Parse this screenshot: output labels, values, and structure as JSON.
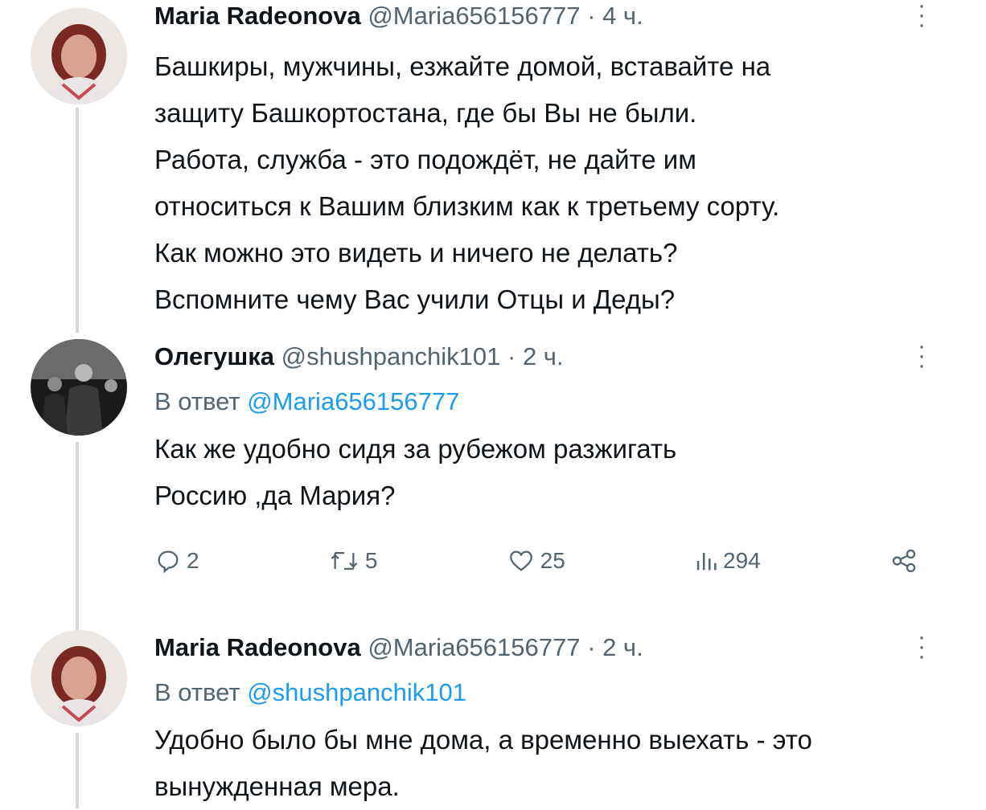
{
  "tweets": [
    {
      "name": "Maria Radeonova",
      "handle": "@Maria656156777",
      "separator": "·",
      "time": "4 ч.",
      "text_lines": [
        "Башкиры, мужчины, езжайте домой, вставайте на",
        "защиту Башкортостана, где бы Вы не были.",
        "Работа, служба - это подождёт, не дайте им",
        "относиться к Вашим близким как к третьему сорту.",
        "Как можно это видеть и ничего не делать?",
        "Вспомните чему Вас учили Отцы и Деды?"
      ]
    },
    {
      "name": "Олегушка",
      "handle": "@shushpanchik101",
      "separator": "·",
      "time": "2 ч.",
      "reply_prefix": "В ответ",
      "reply_mention": "@Maria656156777",
      "text_lines": [
        "Как же удобно сидя за рубежом разжигать",
        "Россию ,да Мария?"
      ],
      "actions": {
        "replies": "2",
        "retweets": "5",
        "likes": "25",
        "views": "294"
      }
    },
    {
      "name": "Maria Radeonova",
      "handle": "@Maria656156777",
      "separator": "·",
      "time": "2 ч.",
      "reply_prefix": "В ответ",
      "reply_mention": "@shushpanchik101",
      "text_lines": [
        "Удобно было бы мне дома, а временно выехать - это",
        "вынужденная мера."
      ]
    }
  ],
  "colors": {
    "text": "#0f1419",
    "secondary": "#536471",
    "link": "#1d9bf0",
    "thread_line": "#cfd9de"
  },
  "icons": [
    "more-icon",
    "reply-icon",
    "retweet-icon",
    "like-icon",
    "views-icon",
    "share-icon"
  ]
}
